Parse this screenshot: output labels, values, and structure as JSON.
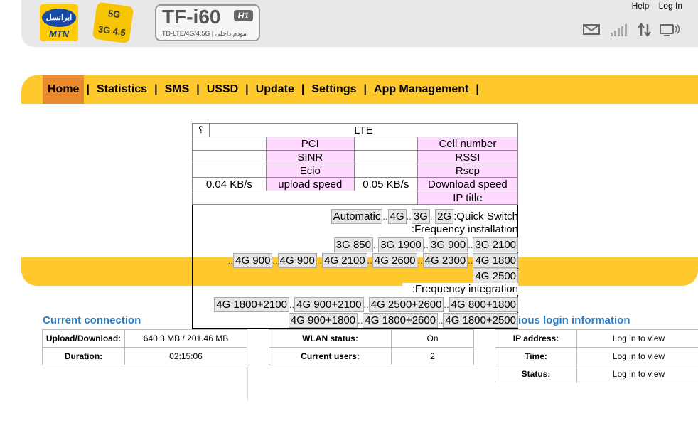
{
  "header": {
    "operator_logo_text": "ایرانسل",
    "operator_brand": "MTN",
    "badge_5g_top": "5G",
    "badge_5g_bottom": "3G 4.5",
    "model": "TF-i60",
    "model_badge": "H1",
    "model_sub": "TD-LTE/4G/4.5G | مودم داخلی",
    "help_link": "Help",
    "login_link": "Log In",
    "icons": [
      "mail-icon",
      "signal-icon",
      "data-transfer-icon",
      "wifi-device-icon"
    ]
  },
  "nav": {
    "items": [
      "Home",
      "Statistics",
      "SMS",
      "USSD",
      "Update",
      "Settings",
      "App Management"
    ],
    "separator": "|",
    "active": "Home"
  },
  "cell_panel": {
    "question": "؟",
    "network_type": "LTE",
    "pci_label": "PCI",
    "cell_number_label": "Cell number",
    "sinr_label": "SINR",
    "rssi_label": "RSSI",
    "ecio_label": "Ecio",
    "rscp_label": "Rscp",
    "upload_value": "0.04 KB/s",
    "upload_label": "upload speed",
    "download_value": "0.05 KB/s",
    "download_label": "Download speed",
    "ip_title_label": "IP title",
    "quick_switch_label": ":Quick Switch",
    "quick_switch_buttons": [
      "Automatic",
      "4G",
      "3G",
      "2G"
    ],
    "freq_install_label": ":Frequency installation",
    "freq_3g_buttons": [
      "3G 850",
      "3G 1900",
      "3G 900",
      "3G 2100"
    ],
    "freq_4g_buttons": [
      "4G 900",
      "4G 900",
      "4G 2100",
      "4G 2600",
      "4G 2300",
      "4G 1800"
    ],
    "freq_4g_extra": "4G 2500",
    "freq_integration_label": ":Frequency integration",
    "ca_row1": [
      "4G 1800+2100",
      "4G 900+2100",
      "4G 2500+2600",
      "4G 800+1800"
    ],
    "ca_row2": [
      "4G 900+1800",
      "4G 1800+2600",
      "4G 1800+2500"
    ],
    "dots": ".."
  },
  "current_connection": {
    "title": "Current connection",
    "upload_download_label": "Upload/Download:",
    "upload_download_value": "640.3 MB / 201.46 MB",
    "duration_label": "Duration:",
    "duration_value": "02:15:06"
  },
  "wlan": {
    "status_label": "WLAN status:",
    "status_value": "On",
    "users_label": "Current users:",
    "users_value": "2"
  },
  "login_info": {
    "title_visible": "ious login information",
    "ip_label": "IP address:",
    "ip_value": "Log in to view",
    "time_label": "Time:",
    "time_value": "Log in to view",
    "status_label": "Status:",
    "status_value": "Log in to view"
  },
  "colors": {
    "nav_bg": "#ffc82d",
    "nav_active": "#ea8a2e",
    "section_title": "#2c7cc4",
    "pink_cell": "#ffd9ff"
  }
}
